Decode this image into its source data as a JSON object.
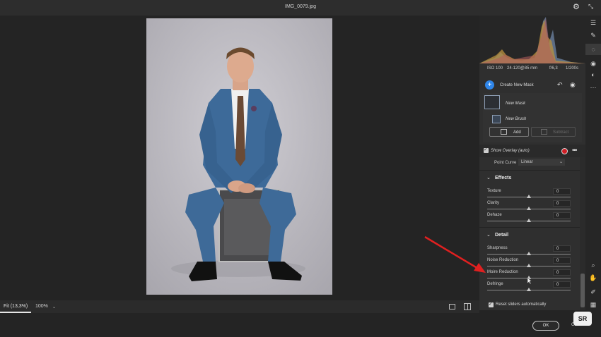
{
  "window": {
    "title": "IMG_0079.jpg"
  },
  "camera_info": {
    "iso": "ISO 100",
    "lens": "24-120@85 mm",
    "aperture": "f/6,3",
    "shutter": "1/200s"
  },
  "masking": {
    "create_label": "Create New Mask",
    "mask_name": "New Mask",
    "brush_name": "New Brush",
    "add_label": "Add",
    "subtract_label": "Subtract",
    "overlay_label": "Show Overlay (auto)",
    "overlay_color": "#d01f26"
  },
  "point_curve": {
    "label": "Point Curve",
    "value": "Linear"
  },
  "effects": {
    "title": "Effects",
    "sliders": [
      {
        "label": "Texture",
        "value": "0"
      },
      {
        "label": "Clarity",
        "value": "0"
      },
      {
        "label": "Dehaze",
        "value": "0"
      }
    ]
  },
  "detail": {
    "title": "Detail",
    "sliders": [
      {
        "label": "Sharpness",
        "value": "0"
      },
      {
        "label": "Noise Reduction",
        "value": "0"
      },
      {
        "label": "Moire Reduction",
        "value": "0"
      },
      {
        "label": "Defringe",
        "value": "0"
      }
    ]
  },
  "reset_label": "Reset sliders automatically",
  "bottom_bar": {
    "fit_label": "Fit (13,3%)",
    "zoom_label": "100%"
  },
  "footer": {
    "ok_label": "OK",
    "cancel_label": "Ca"
  },
  "watermark": "SR",
  "colors": {
    "accent": "#2f86ea",
    "annotation_arrow": "#e02020"
  }
}
